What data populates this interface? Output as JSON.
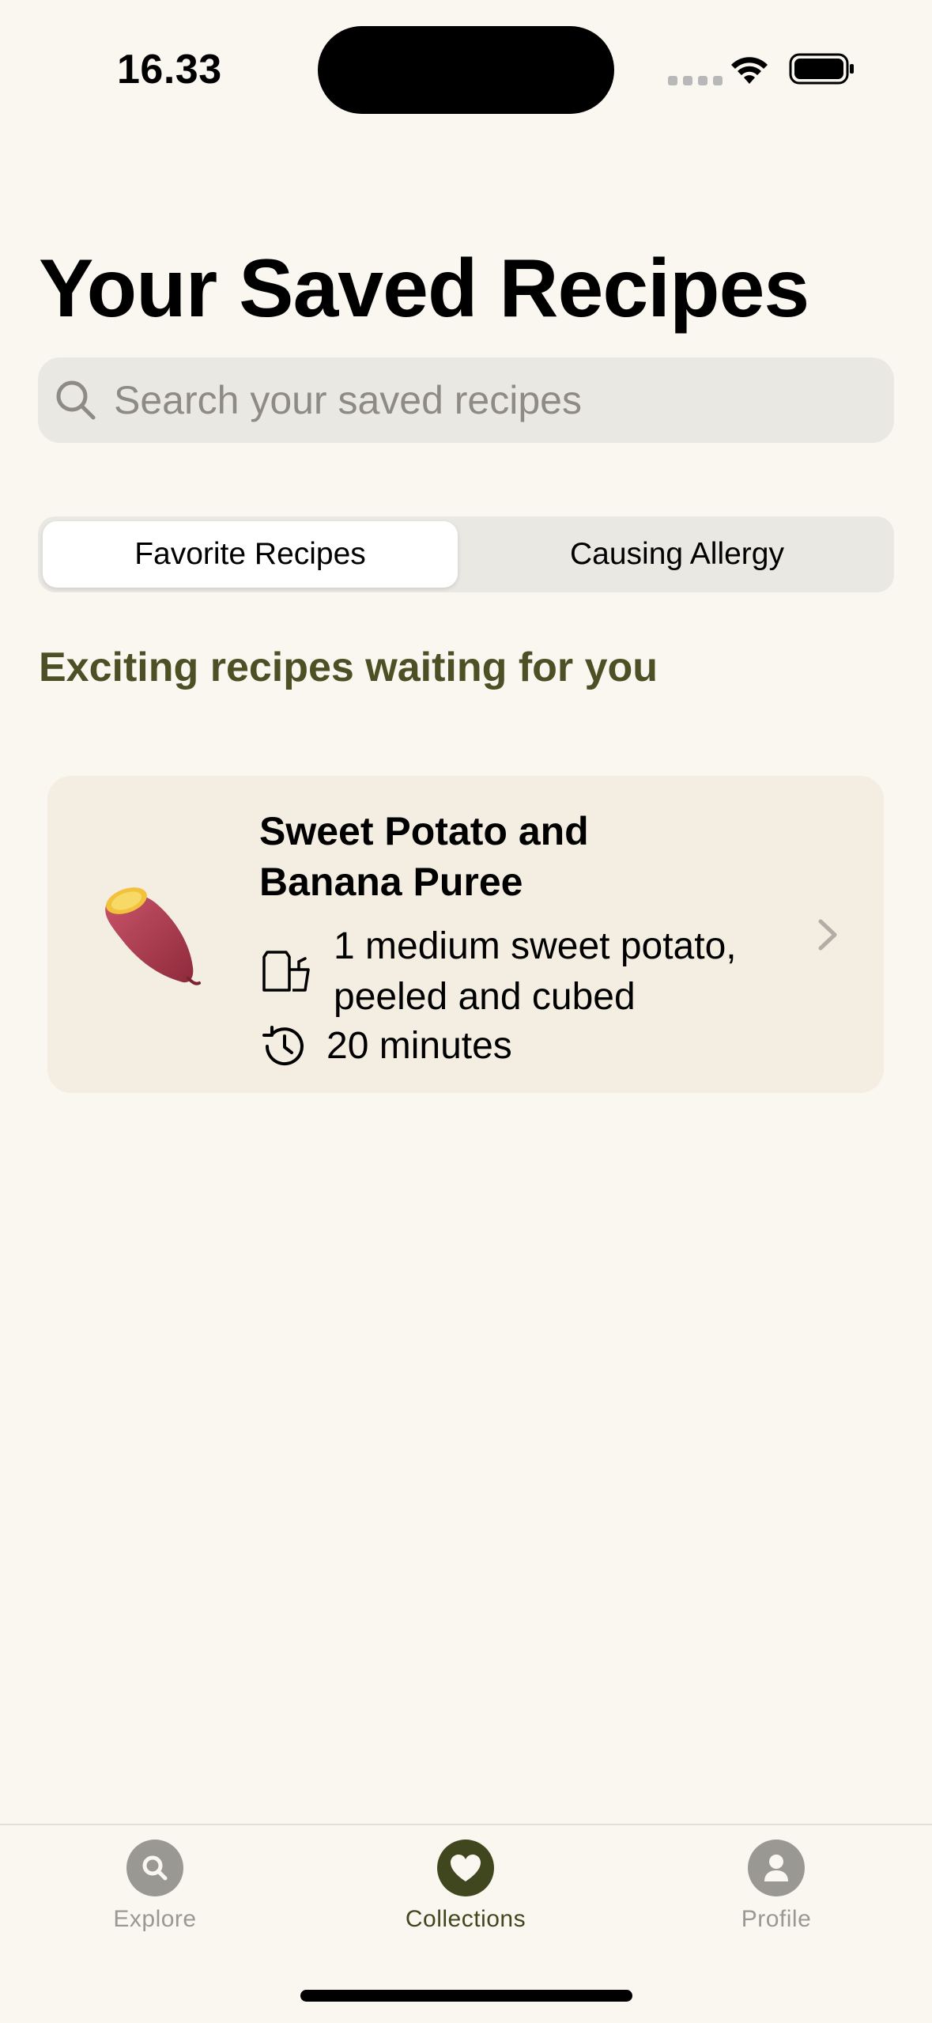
{
  "status_bar": {
    "time": "16.33",
    "icons": [
      "signal-dots-icon",
      "wifi-icon",
      "battery-icon"
    ]
  },
  "header": {
    "title": "Your Saved Recipes"
  },
  "search": {
    "placeholder": "Search your saved recipes",
    "icon": "search-icon"
  },
  "segments": {
    "items": [
      {
        "label": "Favorite Recipes",
        "selected": true
      },
      {
        "label": "Causing Allergy",
        "selected": false
      }
    ]
  },
  "section": {
    "subtitle": "Exciting recipes waiting for you"
  },
  "recipes": [
    {
      "title": "Sweet Potato and Banana Puree",
      "image_icon": "sweet-potato-icon",
      "ingredient_icon": "ingredients-icon",
      "ingredient": "1 medium sweet potato, peeled and cubed",
      "time_icon": "clock-icon",
      "time": "20 minutes"
    }
  ],
  "tab_bar": {
    "tabs": [
      {
        "label": "Explore",
        "icon": "search-icon",
        "active": false
      },
      {
        "label": "Collections",
        "icon": "heart-icon",
        "active": true
      },
      {
        "label": "Profile",
        "icon": "person-icon",
        "active": false
      }
    ]
  },
  "colors": {
    "background": "#faf7f1",
    "accent": "#40471f",
    "subtitle": "#4c5025",
    "card": "#f3eee1",
    "inactive": "#9a9893"
  }
}
